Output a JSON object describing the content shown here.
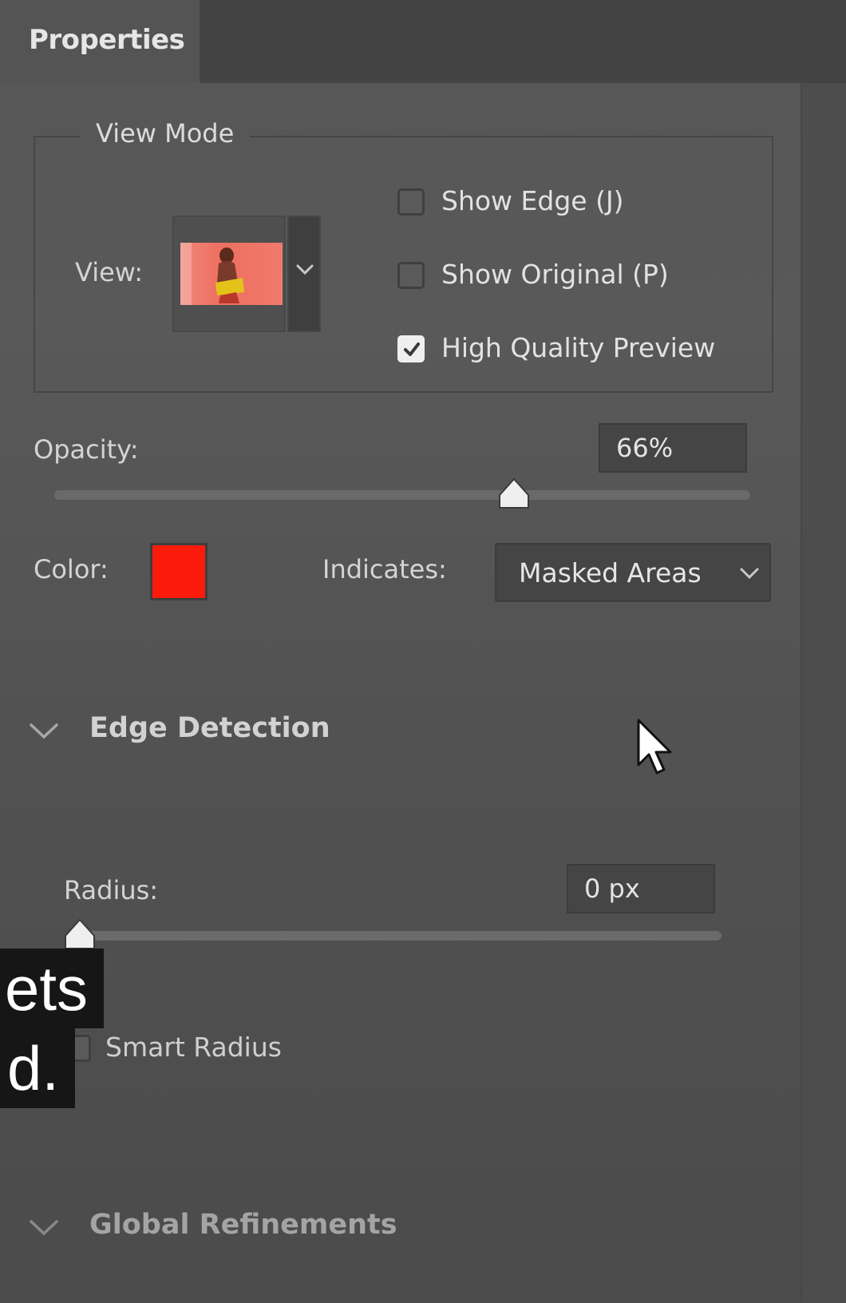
{
  "tab": {
    "title": "Properties"
  },
  "view_mode": {
    "legend": "View Mode",
    "view_label": "View:",
    "thumbnail": "portrait-thumbnail",
    "checkboxes": [
      {
        "label": "Show Edge (J)",
        "checked": false
      },
      {
        "label": "Show Original (P)",
        "checked": false
      },
      {
        "label": "High Quality Preview",
        "checked": true
      }
    ]
  },
  "opacity": {
    "label": "Opacity:",
    "value": "66%",
    "slider_fraction": 0.66
  },
  "color": {
    "label": "Color:",
    "swatch": "#fa1b0a",
    "indicates_label": "Indicates:",
    "indicates_value": "Masked Areas"
  },
  "edge_detection": {
    "title": "Edge Detection",
    "radius_label": "Radius:",
    "radius_value": "0 px",
    "radius_slider_fraction": 0.0,
    "smart_radius_label": "Smart Radius",
    "smart_radius_checked": false
  },
  "global_refinements": {
    "title": "Global Refinements"
  },
  "caption": {
    "line1": "ets",
    "line2": "d."
  },
  "colors": {
    "panel_bg": "#575757",
    "tab_bar": "#434343",
    "swatch": "#fa1b0a",
    "caption_bg": "#161616"
  }
}
